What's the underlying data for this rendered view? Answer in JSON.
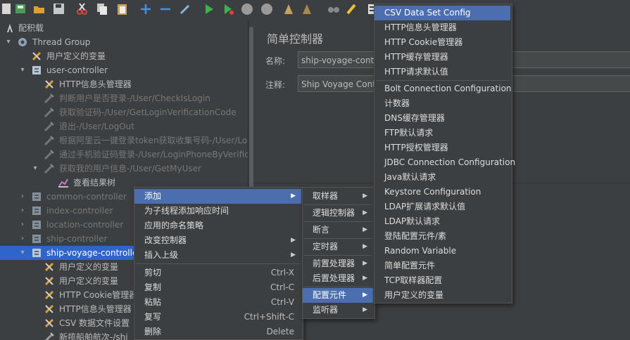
{
  "toolbar": {
    "icons": [
      "new-plan-icon",
      "templates-icon",
      "open-icon",
      "save-icon",
      "cut-icon",
      "copy-icon",
      "paste-icon",
      "expand-icon",
      "collapse-icon",
      "toggle-icon",
      "start-icon",
      "start-no-pause-icon",
      "stop-icon",
      "shutdown-icon",
      "clear-icon",
      "clear-all-icon",
      "search-icon",
      "reset-search-icon",
      "function-helper-icon"
    ]
  },
  "tree": {
    "root": "配积载",
    "thread_group": "Thread Group",
    "items": [
      {
        "label": "用户定义的变量",
        "icon": "config-element-icon",
        "level": 2,
        "arrow": "",
        "dim": false
      },
      {
        "label": "user-controller",
        "icon": "controller-icon",
        "level": 2,
        "arrow": "▾",
        "dim": false
      },
      {
        "label": "HTTP信息头管理器",
        "icon": "config-element-icon",
        "level": 3,
        "arrow": "",
        "dim": false
      },
      {
        "label": "判断用户是否登录-/User/CheckIsLogin",
        "icon": "sampler-icon",
        "level": 3,
        "arrow": "",
        "dim": true
      },
      {
        "label": "获取验证码-/User/GetLoginVerificationCode",
        "icon": "sampler-icon",
        "level": 3,
        "arrow": "",
        "dim": true
      },
      {
        "label": "退出-/User/LogOut",
        "icon": "sampler-icon",
        "level": 3,
        "arrow": "",
        "dim": true
      },
      {
        "label": "根据阿里云一键登录token获取收集号码-/User/Lo",
        "icon": "sampler-icon",
        "level": 3,
        "arrow": "",
        "dim": true
      },
      {
        "label": "通过手机验证码登录-/User/LoginPhoneByVerifica",
        "icon": "sampler-icon",
        "level": 3,
        "arrow": "",
        "dim": true
      },
      {
        "label": "获取我的用户信息-/User/GetMyUser",
        "icon": "sampler-icon",
        "level": 3,
        "arrow": "▾",
        "dim": true
      },
      {
        "label": "查看结果树",
        "icon": "listener-icon",
        "level": 4,
        "arrow": "",
        "dim": false
      },
      {
        "label": "common-controller",
        "icon": "controller-icon",
        "level": 2,
        "arrow": "›",
        "dim": true
      },
      {
        "label": "index-controller",
        "icon": "controller-icon",
        "level": 2,
        "arrow": "›",
        "dim": true
      },
      {
        "label": "location-controller",
        "icon": "controller-icon",
        "level": 2,
        "arrow": "›",
        "dim": true
      },
      {
        "label": "ship-controller",
        "icon": "controller-icon",
        "level": 2,
        "arrow": "›",
        "dim": true
      },
      {
        "label": "ship-voyage-controller",
        "icon": "controller-icon",
        "level": 2,
        "arrow": "▾",
        "dim": false,
        "selected": true
      },
      {
        "label": "用户定义的变量",
        "icon": "config-element-icon",
        "level": 3,
        "arrow": "",
        "dim": false
      },
      {
        "label": "用户定义的变量",
        "icon": "config-element-icon",
        "level": 3,
        "arrow": "",
        "dim": false
      },
      {
        "label": "HTTP Cookie管理器",
        "icon": "config-element-icon",
        "level": 3,
        "arrow": "",
        "dim": false
      },
      {
        "label": "HTTP信息头管理器",
        "icon": "config-element-icon",
        "level": 3,
        "arrow": "",
        "dim": false
      },
      {
        "label": "CSV 数据文件设置",
        "icon": "config-element-icon",
        "level": 3,
        "arrow": "",
        "dim": false
      },
      {
        "label": "新揽船舶航次-/shi",
        "icon": "sampler-icon",
        "level": 3,
        "arrow": "",
        "dim": false
      }
    ]
  },
  "panel": {
    "title": "简单控制器",
    "name_label": "名称:",
    "name_value": "ship-voyage-controller",
    "comment_label": "注释:",
    "comment_value": "Ship Voyage Controller"
  },
  "context_menu": [
    {
      "label": "添加",
      "sub": true,
      "hl": true
    },
    {
      "label": "为子线程添加响应时间"
    },
    {
      "label": "应用的命名策略"
    },
    {
      "label": "改变控制器",
      "sub": true
    },
    {
      "label": "插入上级",
      "sub": true,
      "sep_after": true
    },
    {
      "label": "剪切",
      "key": "Ctrl-X"
    },
    {
      "label": "复制",
      "key": "Ctrl-C"
    },
    {
      "label": "粘贴",
      "key": "Ctrl-V"
    },
    {
      "label": "复写",
      "key": "Ctrl+Shift-C"
    },
    {
      "label": "删除",
      "key": "Delete"
    }
  ],
  "add_submenu": [
    {
      "label": "取样器",
      "sep_after": true
    },
    {
      "label": "逻辑控制器",
      "sep_after": true
    },
    {
      "label": "断言",
      "sep_after": true
    },
    {
      "label": "定时器",
      "sep_after": true
    },
    {
      "label": "前置处理器"
    },
    {
      "label": "后置处理器",
      "sep_after": true
    },
    {
      "label": "配置元件",
      "hl": true
    },
    {
      "label": "监听器"
    }
  ],
  "config_submenu": [
    {
      "label": "CSV Data Set Config",
      "hl": true
    },
    {
      "label": "HTTP信息头管理器"
    },
    {
      "label": "HTTP Cookie管理器"
    },
    {
      "label": "HTTP缓存管理器"
    },
    {
      "label": "HTTP请求默认值",
      "sep_after": true
    },
    {
      "label": "Bolt Connection Configuration"
    },
    {
      "label": "计数器"
    },
    {
      "label": "DNS缓存管理器"
    },
    {
      "label": "FTP默认请求"
    },
    {
      "label": "HTTP授权管理器"
    },
    {
      "label": "JDBC Connection Configuration"
    },
    {
      "label": "Java默认请求"
    },
    {
      "label": "Keystore Configuration"
    },
    {
      "label": "LDAP扩展请求默认值"
    },
    {
      "label": "LDAP默认请求"
    },
    {
      "label": "登陆配置元件/素"
    },
    {
      "label": "Random Variable"
    },
    {
      "label": "简单配置元件"
    },
    {
      "label": "TCP取样器配置"
    },
    {
      "label": "用户定义的变量"
    }
  ]
}
